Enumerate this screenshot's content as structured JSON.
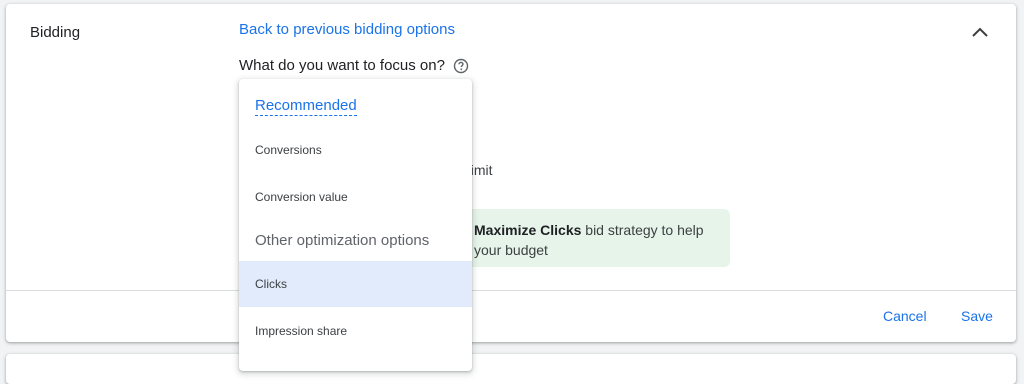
{
  "section": {
    "title": "Bidding",
    "back_link": "Back to previous bidding options",
    "question": "What do you want to focus on?"
  },
  "background": {
    "partial_text": "d limit",
    "info_box": {
      "bold": "Maximize Clicks",
      "line1_rest": " bid strategy to help",
      "line2": "your budget"
    }
  },
  "dropdown": {
    "recommended_header": "Recommended",
    "recommended_items": [
      "Conversions",
      "Conversion value"
    ],
    "other_header": "Other optimization options",
    "other_items": [
      "Clicks",
      "Impression share"
    ],
    "selected": "Clicks"
  },
  "footer": {
    "cancel_label": "Cancel",
    "save_label": "Save"
  },
  "colors": {
    "accent": "#1a73e8",
    "selected_bg": "#e1ebfb",
    "info_bg": "#e6f4ea"
  },
  "icons": {
    "collapse": "chevron-up-icon",
    "help": "help-circle-icon"
  }
}
